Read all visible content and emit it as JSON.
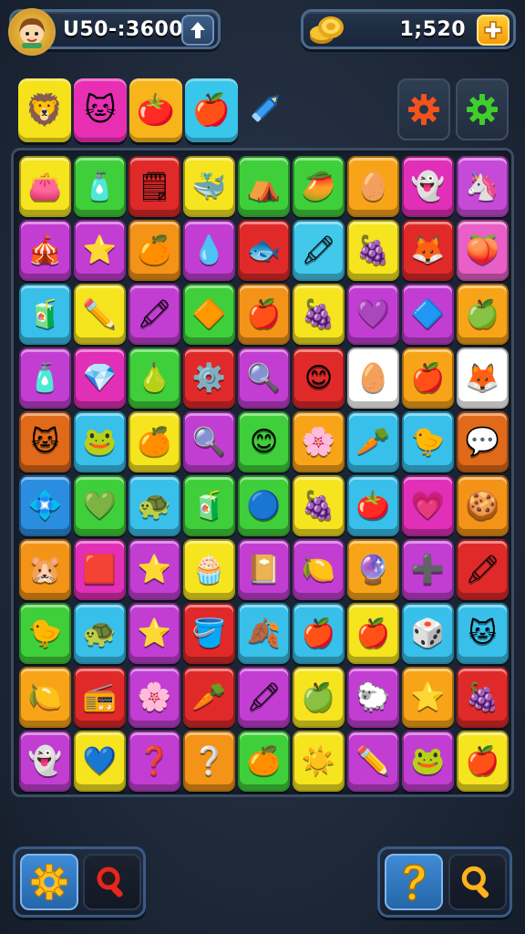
{
  "hud": {
    "score_text": "U50-:3600",
    "coins_text": "1;520",
    "avatar_icon": "girl-avatar-icon",
    "coin_icon": "coin-stack-icon",
    "plus_icon": "plus-icon",
    "arrow_icon": "up-arrow-icon"
  },
  "boosters": [
    {
      "icon": "lion-face-icon",
      "glyph": "🦁",
      "color": "#f5e21a"
    },
    {
      "icon": "cat-face-icon",
      "glyph": "🐱",
      "color": "#e82fb4"
    },
    {
      "icon": "tomato-icon",
      "glyph": "🍅",
      "color": "#f7b51b"
    },
    {
      "icon": "apple-icon",
      "glyph": "🍎",
      "color": "#38c6ea"
    }
  ],
  "tools": {
    "pencil_icon": "pencil-icon",
    "settings_icon": "gear-icon-orange",
    "options_icon": "gear-icon-green"
  },
  "board": {
    "rows": [
      [
        {
          "g": "👛",
          "c": "#f6e41f"
        },
        {
          "g": "🧴",
          "c": "#3fcf3a"
        },
        {
          "g": "🗒",
          "c": "#e02a2a"
        },
        {
          "g": "🐳",
          "c": "#f6e41f"
        },
        {
          "g": "⛺",
          "c": "#3fcf3a"
        },
        {
          "g": "🥭",
          "c": "#3fcf3a"
        },
        {
          "g": "🥚",
          "c": "#f8a418"
        },
        {
          "g": "👻",
          "c": "#e12fb8"
        },
        {
          "g": "🦄",
          "c": "#c64ad8"
        }
      ],
      [
        {
          "g": "🎪",
          "c": "#c23ed2"
        },
        {
          "g": "⭐",
          "c": "#c23ed2"
        },
        {
          "g": "🍊",
          "c": "#f39317"
        },
        {
          "g": "💧",
          "c": "#c23ed2"
        },
        {
          "g": "🐟",
          "c": "#e02a2a"
        },
        {
          "g": "🖍",
          "c": "#42c8ea"
        },
        {
          "g": "🍇",
          "c": "#f6e41f"
        },
        {
          "g": "🦊",
          "c": "#e02a2a"
        },
        {
          "g": "🍑",
          "c": "#e860c6"
        }
      ],
      [
        {
          "g": "🧃",
          "c": "#38c0ea"
        },
        {
          "g": "✏️",
          "c": "#f6e41f"
        },
        {
          "g": "🖍",
          "c": "#c23ed2"
        },
        {
          "g": "🔶",
          "c": "#3fcf3a"
        },
        {
          "g": "🍎",
          "c": "#f39317"
        },
        {
          "g": "🍇",
          "c": "#f6e41f"
        },
        {
          "g": "💜",
          "c": "#c23ed2"
        },
        {
          "g": "🔷",
          "c": "#c23ed2"
        },
        {
          "g": "🍏",
          "c": "#f8a418"
        }
      ],
      [
        {
          "g": "🧴",
          "c": "#c23ed2"
        },
        {
          "g": "💎",
          "c": "#e12fb8"
        },
        {
          "g": "🍐",
          "c": "#3fcf3a"
        },
        {
          "g": "⚙️",
          "c": "#e02a2a"
        },
        {
          "g": "🔍",
          "c": "#c23ed2"
        },
        {
          "g": "😊",
          "c": "#e02a2a"
        },
        {
          "g": "🥚",
          "c": "#ffffff"
        },
        {
          "g": "🍎",
          "c": "#f8a418"
        },
        {
          "g": "🦊",
          "c": "#ffffff"
        }
      ],
      [
        {
          "g": "🐱",
          "c": "#e06a1a"
        },
        {
          "g": "🐸",
          "c": "#38c0ea"
        },
        {
          "g": "🍊",
          "c": "#f6e41f"
        },
        {
          "g": "🔍",
          "c": "#c23ed2"
        },
        {
          "g": "😊",
          "c": "#3fcf3a"
        },
        {
          "g": "🌸",
          "c": "#f8a418"
        },
        {
          "g": "🥕",
          "c": "#38c0ea"
        },
        {
          "g": "🐤",
          "c": "#38c0ea"
        },
        {
          "g": "💬",
          "c": "#e06a1a"
        }
      ],
      [
        {
          "g": "💠",
          "c": "#2b8de0"
        },
        {
          "g": "💚",
          "c": "#3fcf3a"
        },
        {
          "g": "🐢",
          "c": "#38c0ea"
        },
        {
          "g": "🧃",
          "c": "#3fcf3a"
        },
        {
          "g": "🔵",
          "c": "#3fcf3a"
        },
        {
          "g": "🍇",
          "c": "#f6e41f"
        },
        {
          "g": "🍅",
          "c": "#38c0ea"
        },
        {
          "g": "💗",
          "c": "#e12fb8"
        },
        {
          "g": "🍪",
          "c": "#f39317"
        }
      ],
      [
        {
          "g": "🐹",
          "c": "#f39317"
        },
        {
          "g": "🟥",
          "c": "#e12fb8"
        },
        {
          "g": "⭐",
          "c": "#c23ed2"
        },
        {
          "g": "🧁",
          "c": "#f6e41f"
        },
        {
          "g": "📔",
          "c": "#c23ed2"
        },
        {
          "g": "🍋",
          "c": "#c23ed2"
        },
        {
          "g": "🔮",
          "c": "#f8a418"
        },
        {
          "g": "➕",
          "c": "#c23ed2"
        },
        {
          "g": "🖍",
          "c": "#e02a2a"
        }
      ],
      [
        {
          "g": "🐤",
          "c": "#3fcf3a"
        },
        {
          "g": "🐢",
          "c": "#38c0ea"
        },
        {
          "g": "⭐",
          "c": "#c23ed2"
        },
        {
          "g": "🪣",
          "c": "#e02a2a"
        },
        {
          "g": "🍂",
          "c": "#38c0ea"
        },
        {
          "g": "🍎",
          "c": "#38c0ea"
        },
        {
          "g": "🍎",
          "c": "#f6e41f"
        },
        {
          "g": "🎲",
          "c": "#38c0ea"
        },
        {
          "g": "🐱",
          "c": "#38c0ea"
        }
      ],
      [
        {
          "g": "🍋",
          "c": "#f8a418"
        },
        {
          "g": "📻",
          "c": "#e02a2a"
        },
        {
          "g": "🌸",
          "c": "#c23ed2"
        },
        {
          "g": "🥕",
          "c": "#e02a2a"
        },
        {
          "g": "🖍",
          "c": "#c23ed2"
        },
        {
          "g": "🍏",
          "c": "#f6e41f"
        },
        {
          "g": "🐑",
          "c": "#c23ed2"
        },
        {
          "g": "⭐",
          "c": "#f8a418"
        },
        {
          "g": "🍇",
          "c": "#e02a2a"
        }
      ],
      [
        {
          "g": "👻",
          "c": "#c23ed2"
        },
        {
          "g": "💙",
          "c": "#f6e41f"
        },
        {
          "g": "❓",
          "c": "#c23ed2"
        },
        {
          "g": "❔",
          "c": "#f39317"
        },
        {
          "g": "🍊",
          "c": "#3fcf3a"
        },
        {
          "g": "☀️",
          "c": "#f6e41f"
        },
        {
          "g": "✏️",
          "c": "#c23ed2"
        },
        {
          "g": "🐸",
          "c": "#c23ed2"
        },
        {
          "g": "🍎",
          "c": "#f6e41f"
        }
      ]
    ]
  },
  "bottom": {
    "left": {
      "gear_icon": "gear-icon-yellow",
      "magnet_icon": "magnifier-red-icon"
    },
    "right": {
      "hint_icon": "question-mark-icon",
      "search_icon": "magnifier-yellow-icon"
    }
  }
}
